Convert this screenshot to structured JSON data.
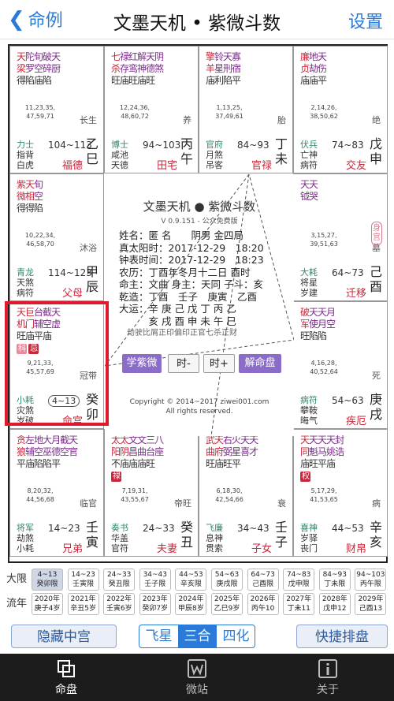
{
  "nav": {
    "back": "命例",
    "title": "文墨天机 • 紫微斗数",
    "settings": "设置"
  },
  "cells": [
    {
      "id": "si",
      "stars": [
        [
          [
            "天",
            "r"
          ],
          [
            "陀",
            "p"
          ],
          [
            "旬",
            "p"
          ],
          [
            "破",
            "p"
          ],
          [
            "天",
            "p"
          ]
        ],
        [
          [
            "梁",
            "r"
          ],
          [
            "罗",
            "p"
          ],
          [
            "空",
            "p"
          ],
          [
            "碎",
            "p"
          ],
          [
            "厨",
            "p"
          ]
        ],
        [
          [
            "得",
            "b"
          ],
          [
            "陷",
            "b"
          ],
          [
            "庙",
            "b"
          ],
          [
            "陷",
            "b"
          ]
        ]
      ],
      "ages": "11,23,35,\n47,59,71",
      "stage": "长生",
      "minor": [
        "力士",
        "指背",
        "白虎"
      ],
      "range": "104~113",
      "gz": "乙巳",
      "palace": "福德"
    },
    {
      "id": "wu",
      "stars": [
        [
          [
            "七",
            "r"
          ],
          [
            "禄",
            "p"
          ],
          [
            "红",
            "p"
          ],
          [
            "解",
            "p"
          ],
          [
            "天",
            "p"
          ],
          [
            "阴",
            "p"
          ]
        ],
        [
          [
            "杀",
            "r"
          ],
          [
            "存",
            "p"
          ],
          [
            "鸾",
            "p"
          ],
          [
            "神",
            "p"
          ],
          [
            "德",
            "p"
          ],
          [
            "煞",
            "p"
          ]
        ],
        [
          [
            "旺",
            "b"
          ],
          [
            "庙",
            "b"
          ],
          [
            "旺",
            "b"
          ],
          [
            "庙",
            "b"
          ],
          [
            "旺",
            "b"
          ]
        ]
      ],
      "ages": "12,24,36,\n48,60,72",
      "stage": "养",
      "minor": [
        "博士",
        "咸池",
        "天德"
      ],
      "range": "94~103",
      "gz": "丙午",
      "palace": "田宅"
    },
    {
      "id": "wei",
      "stars": [
        [
          [
            "擎",
            "r"
          ],
          [
            "铃",
            "p"
          ],
          [
            "天",
            "p"
          ],
          [
            "寡",
            "p"
          ]
        ],
        [
          [
            "羊",
            "r"
          ],
          [
            "星",
            "p"
          ],
          [
            "刑",
            "p"
          ],
          [
            "宿",
            "p"
          ]
        ],
        [
          [
            "庙",
            "b"
          ],
          [
            "利",
            "b"
          ],
          [
            "陷",
            "b"
          ],
          [
            "平",
            "b"
          ]
        ]
      ],
      "ages": "1,13,25,\n37,49,61",
      "stage": "胎",
      "minor": [
        "官府",
        "月煞",
        "吊客"
      ],
      "range": "84~93",
      "gz": "丁未",
      "palace": "官禄"
    },
    {
      "id": "shen",
      "stars": [
        [
          [
            "廉",
            "r"
          ],
          [
            "地",
            "p"
          ],
          [
            "天",
            "p"
          ]
        ],
        [
          [
            "贞",
            "r"
          ],
          [
            "劫",
            "p"
          ],
          [
            "伤",
            "p"
          ]
        ],
        [
          [
            "庙",
            "b"
          ],
          [
            "庙",
            "b"
          ],
          [
            "平",
            "b"
          ]
        ]
      ],
      "ages": "2,14,26,\n38,50,62",
      "stage": "绝",
      "minor": [
        "伏兵",
        "亡神",
        "病符"
      ],
      "range": "74~83",
      "gz": "戊申",
      "palace": "交友"
    },
    {
      "id": "chen",
      "stars": [
        [
          [
            "紫",
            "r"
          ],
          [
            "天",
            "r"
          ],
          [
            "旬",
            "p"
          ]
        ],
        [
          [
            "微",
            "r"
          ],
          [
            "相",
            "r"
          ],
          [
            "空",
            "p"
          ]
        ],
        [
          [
            "得",
            "b"
          ],
          [
            "得",
            "b"
          ],
          [
            "陷",
            "b"
          ]
        ]
      ],
      "ages": "10,22,34,\n46,58,70",
      "stage": "沐浴",
      "minor": [
        "青龙",
        "天煞",
        "病符"
      ],
      "range": "114~123",
      "gz": "甲辰",
      "palace": "父母"
    },
    {
      "id": "you",
      "stars": [
        [
          [
            "天",
            "p"
          ],
          [
            "天",
            "p"
          ]
        ],
        [
          [
            "钺",
            "p"
          ],
          [
            "哭",
            "p"
          ]
        ],
        [
          [
            "",
            ""
          ]
        ]
      ],
      "ages": "3,15,27,\n39,51,63",
      "stage": "墓",
      "minor": [
        "大耗",
        "将星",
        "岁建"
      ],
      "range": "64~73",
      "gz": "己酉",
      "palace": "迁移",
      "stamp": "身宫"
    },
    {
      "id": "mao",
      "stars": [
        [
          [
            "天",
            "r"
          ],
          [
            "巨",
            "r"
          ],
          [
            "台",
            "p"
          ],
          [
            "截",
            "p"
          ],
          [
            "天",
            "p"
          ]
        ],
        [
          [
            "机",
            "r"
          ],
          [
            "门",
            "r"
          ],
          [
            "辅",
            "p"
          ],
          [
            "空",
            "p"
          ],
          [
            "虚",
            "p"
          ]
        ],
        [
          [
            "旺",
            "b"
          ],
          [
            "庙",
            "b"
          ],
          [
            "平",
            "b"
          ],
          [
            "庙",
            "b"
          ]
        ]
      ],
      "badges": [
        [
          "科",
          "pk"
        ],
        [
          "忌",
          "r"
        ]
      ],
      "ages": "9,21,33,\n45,57,69",
      "stage": "冠带",
      "minor": [
        "小耗",
        "灾煞",
        "岁破"
      ],
      "range": "4~13",
      "gz": "癸卯",
      "palace": "命宫"
    },
    {
      "id": "xu",
      "stars": [
        [
          [
            "破",
            "r"
          ],
          [
            "天",
            "p"
          ],
          [
            "天",
            "p"
          ],
          [
            "月",
            "p"
          ]
        ],
        [
          [
            "军",
            "r"
          ],
          [
            "使",
            "p"
          ],
          [
            "月",
            "p"
          ],
          [
            "空",
            "p"
          ]
        ],
        [
          [
            "旺",
            "b"
          ],
          [
            "陷",
            "b"
          ],
          [
            "陷",
            "b"
          ]
        ]
      ],
      "ages": "4,16,28,\n40,52,64",
      "stage": "死",
      "minor": [
        "病符",
        "攀鞍",
        "晦气"
      ],
      "range": "54~63",
      "gz": "庚戌",
      "palace": "疾厄"
    },
    {
      "id": "yin",
      "stars": [
        [
          [
            "贪",
            "r"
          ],
          [
            "左",
            "p"
          ],
          [
            "地",
            "p"
          ],
          [
            "大",
            "p"
          ],
          [
            "月",
            "p"
          ],
          [
            "截",
            "p"
          ],
          [
            "天",
            "p"
          ]
        ],
        [
          [
            "狼",
            "r"
          ],
          [
            "辅",
            "p"
          ],
          [
            "空",
            "p"
          ],
          [
            "巫",
            "p"
          ],
          [
            "德",
            "p"
          ],
          [
            "空",
            "p"
          ],
          [
            "官",
            "p"
          ]
        ],
        [
          [
            "平",
            "b"
          ],
          [
            "庙",
            "b"
          ],
          [
            "陷",
            "b"
          ],
          [
            "陷",
            "b"
          ],
          [
            "平",
            "b"
          ]
        ]
      ],
      "ages": "8,20,32,\n44,56,68",
      "stage": "临官",
      "minor": [
        "将军",
        "劫煞",
        "小耗"
      ],
      "range": "14~23",
      "gz": "壬寅",
      "palace": "兄弟"
    },
    {
      "id": "chou",
      "stars": [
        [
          [
            "太",
            "r"
          ],
          [
            "太",
            "r"
          ],
          [
            "文",
            "p"
          ],
          [
            "文",
            "p"
          ],
          [
            "三",
            "p"
          ],
          [
            "八",
            "p"
          ]
        ],
        [
          [
            "阳",
            "r"
          ],
          [
            "阴",
            "r"
          ],
          [
            "昌",
            "p"
          ],
          [
            "曲",
            "p"
          ],
          [
            "台",
            "p"
          ],
          [
            "座",
            "p"
          ]
        ],
        [
          [
            "不",
            "b"
          ],
          [
            "庙",
            "b"
          ],
          [
            "庙",
            "b"
          ],
          [
            "庙",
            "b"
          ],
          [
            "旺",
            "b"
          ]
        ]
      ],
      "badges": [
        [
          "禄",
          "r"
        ]
      ],
      "ages": "7,19,31,\n43,55,67",
      "stage": "帝旺",
      "minor": [
        "奏书",
        "华盖",
        "官符"
      ],
      "range": "24~33",
      "gz": "癸丑",
      "palace": "夫妻"
    },
    {
      "id": "zi",
      "stars": [
        [
          [
            "武",
            "r"
          ],
          [
            "天",
            "r"
          ],
          [
            "右",
            "p"
          ],
          [
            "火",
            "p"
          ],
          [
            "天",
            "p"
          ],
          [
            "天",
            "p"
          ]
        ],
        [
          [
            "曲",
            "r"
          ],
          [
            "府",
            "r"
          ],
          [
            "弼",
            "p"
          ],
          [
            "星",
            "p"
          ],
          [
            "喜",
            "p"
          ],
          [
            "才",
            "p"
          ]
        ],
        [
          [
            "旺",
            "b"
          ],
          [
            "庙",
            "b"
          ],
          [
            "旺",
            "b"
          ],
          [
            "平",
            "b"
          ]
        ]
      ],
      "ages": "6,18,30,\n42,54,66",
      "stage": "衰",
      "minor": [
        "飞廉",
        "息神",
        "贯索"
      ],
      "range": "34~43",
      "gz": "壬子",
      "palace": "子女"
    },
    {
      "id": "hai",
      "stars": [
        [
          [
            "天",
            "r"
          ],
          [
            "天",
            "p"
          ],
          [
            "天",
            "p"
          ],
          [
            "天",
            "p"
          ],
          [
            "封",
            "p"
          ]
        ],
        [
          [
            "同",
            "r"
          ],
          [
            "魁",
            "p"
          ],
          [
            "马",
            "p"
          ],
          [
            "姚",
            "p"
          ],
          [
            "诰",
            "p"
          ]
        ],
        [
          [
            "庙",
            "b"
          ],
          [
            "旺",
            "b"
          ],
          [
            "平",
            "b"
          ],
          [
            "庙",
            "b"
          ]
        ]
      ],
      "badges": [
        [
          "权",
          "r"
        ]
      ],
      "ages": "5,17,29,\n41,53,65",
      "stage": "病",
      "minor": [
        "喜神",
        "岁驿",
        "丧门"
      ],
      "range": "44~53",
      "gz": "辛亥",
      "palace": "财帛"
    }
  ],
  "center": {
    "title": "文墨天机 ● 紫微斗数",
    "version": "V 0.9.151 - 公众免费版",
    "lines": [
      "姓名：匿 名　　阴男 金四局",
      "真太阳时：2017-12-29　18:20",
      "钟表时间：2017-12-29　18:23",
      "农历：丁酉年冬月十二日 酉时",
      "命主：文曲 身主：天同 子斗：亥",
      "乾造：丁酉　壬子　庚寅　乙酉",
      "大运：辛 庚 己 戊 丁 丙 乙",
      "　　　亥 戌 酉 申 未 午 巳",
      "　劫驶比屑正印偏印正官七杀正财"
    ],
    "buttons": [
      "学紫微",
      "时-",
      "时+",
      "解命盘"
    ],
    "copyright": "Copyright © 2014~2017 ziwei001.com\nAll rights reserved."
  },
  "limits": {
    "row1_label": "大限",
    "row1": [
      [
        "4~13",
        "癸卯限"
      ],
      [
        "14~23",
        "壬寅限"
      ],
      [
        "24~33",
        "癸丑限"
      ],
      [
        "34~43",
        "壬子限"
      ],
      [
        "44~53",
        "辛亥限"
      ],
      [
        "54~63",
        "庚戌限"
      ],
      [
        "64~73",
        "己酉限"
      ],
      [
        "74~83",
        "戊申限"
      ],
      [
        "84~93",
        "丁未限"
      ],
      [
        "94~103",
        "丙午限"
      ]
    ],
    "row2_label": "流年",
    "row2": [
      [
        "2020年",
        "庚子4岁"
      ],
      [
        "2021年",
        "辛丑5岁"
      ],
      [
        "2022年",
        "壬寅6岁"
      ],
      [
        "2023年",
        "癸卯7岁"
      ],
      [
        "2024年",
        "甲辰8岁"
      ],
      [
        "2025年",
        "乙巳9岁"
      ],
      [
        "2026年",
        "丙午10"
      ],
      [
        "2027年",
        "丁未11"
      ],
      [
        "2028年",
        "戊申12"
      ],
      [
        "2029年",
        "己酉13"
      ]
    ]
  },
  "toolbar": {
    "hide_center": "隐藏中宫",
    "seg": [
      "飞星",
      "三合",
      "四化"
    ],
    "quick": "快捷排盘"
  },
  "tabs": [
    {
      "label": "命盘"
    },
    {
      "label": "微站"
    },
    {
      "label": "关于"
    }
  ]
}
